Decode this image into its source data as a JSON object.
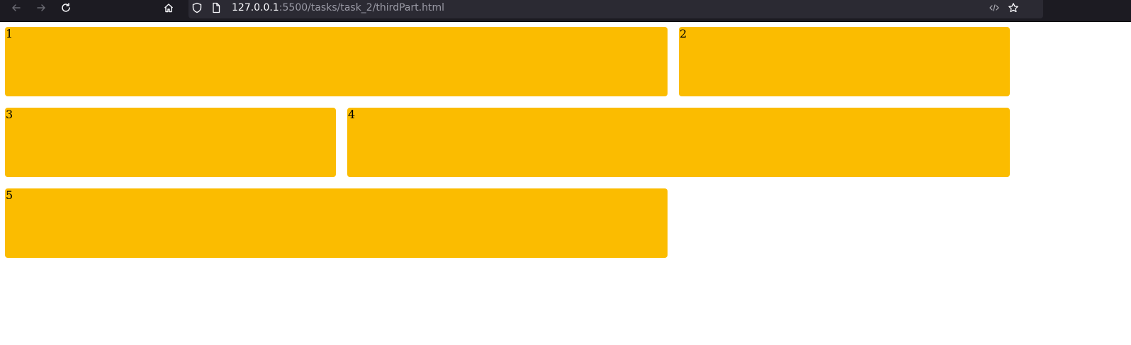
{
  "browser": {
    "url_host": "127.0.0.1",
    "url_path": ":5500/tasks/task_2/thirdPart.html",
    "icons": [
      "back-arrow-icon",
      "forward-arrow-icon",
      "reload-icon",
      "home-icon",
      "shield-icon",
      "page-icon",
      "code-icon",
      "star-icon"
    ]
  },
  "colors": {
    "box": "#fbbc00",
    "toolbar": "#1c1b22",
    "urlbar": "#2b2a33"
  },
  "boxes": [
    {
      "label": "1"
    },
    {
      "label": "2"
    },
    {
      "label": "3"
    },
    {
      "label": "4"
    },
    {
      "label": "5"
    }
  ]
}
